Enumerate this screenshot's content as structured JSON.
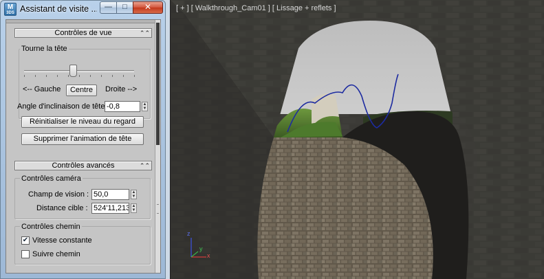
{
  "window": {
    "title": "Assistant de visite ...",
    "app_icon": {
      "letters": "M",
      "sub": "3DS"
    },
    "min_glyph": "—",
    "max_glyph": "□",
    "close_glyph": "✕"
  },
  "view_controls": {
    "header": "Contrôles de vue",
    "head_turn_label": "Tourne la tête",
    "head_turn_value": 0.45,
    "left_label": "<-- Gauche",
    "center_button": "Centre",
    "right_label": "Droite -->",
    "tilt_label": "Angle d'inclinaison de tête",
    "tilt_value": "-0,8",
    "reset_button": "Réinitialiser le niveau du regard",
    "delete_button": "Supprimer l'animation de tête"
  },
  "advanced_controls": {
    "header": "Contrôles avancés",
    "camera_group": "Contrôles caméra",
    "fov_label": "Champ de vision :",
    "fov_value": "50,0",
    "target_label": "Distance cible :",
    "target_value": "524'11,213",
    "path_group": "Contrôles chemin",
    "constant_speed_label": "Vitesse constante",
    "constant_speed_checked": true,
    "follow_path_label": "Suivre chemin",
    "follow_path_checked": false
  },
  "viewport": {
    "label": "[ + ] [ Walkthrough_Cam01 ] [ Lissage + reflets ]",
    "axis_x": "x",
    "axis_y": "y",
    "axis_z": "z",
    "colors": {
      "sky": "#c3c3c3",
      "wall": "#3e3d3a",
      "path_spline": "#1d2ba0",
      "cobble": "#7b6f5e"
    }
  }
}
